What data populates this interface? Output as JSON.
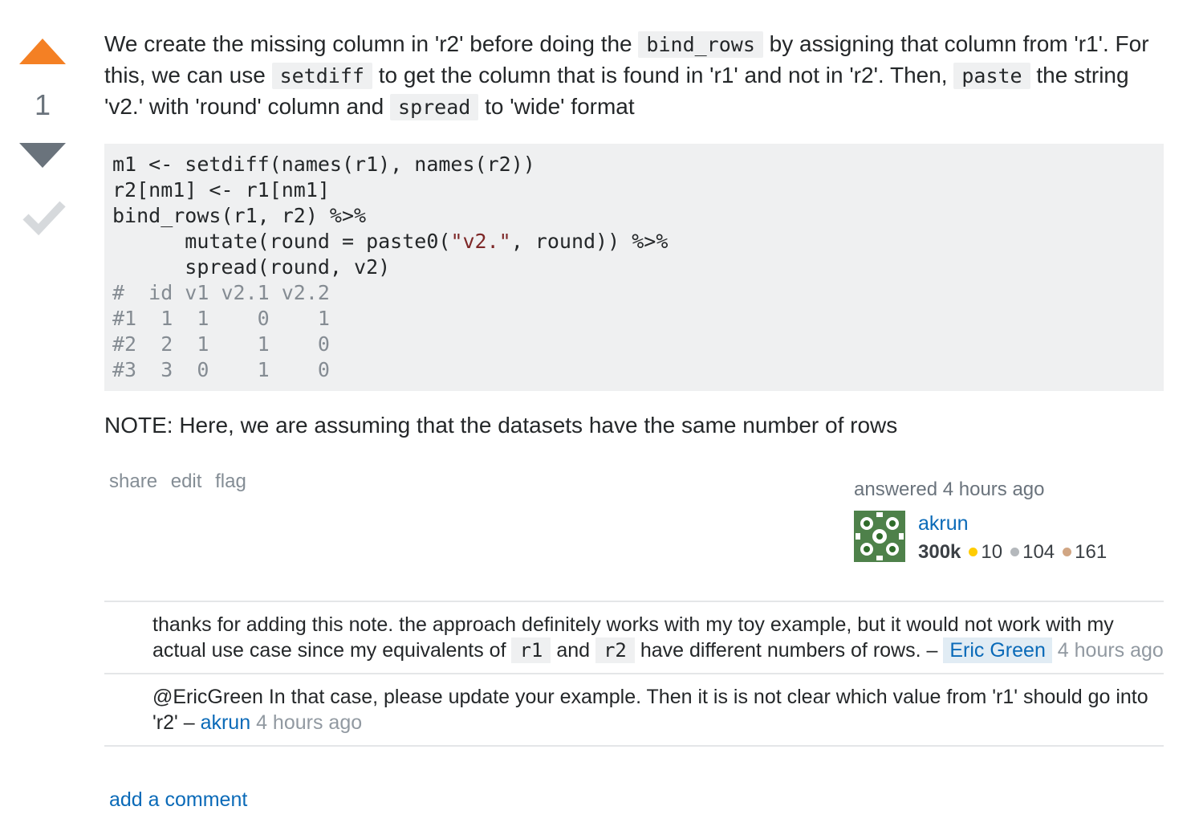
{
  "vote": {
    "count": "1"
  },
  "answer": {
    "text": {
      "p1": "We create the missing column in 'r2' before doing the ",
      "c1": "bind_rows",
      "p2": " by assigning that column from 'r1'. For this, we can use ",
      "c2": "setdiff",
      "p3": " to get the column that is found in 'r1' and not in 'r2'. Then, ",
      "c3": "paste",
      "p4": " the string 'v2.' with 'round' column and ",
      "c4": "spread",
      "p5": " to 'wide' format"
    },
    "code": {
      "line1": "m1 <- setdiff(names(r1), names(r2))",
      "line2": "r2[nm1] <- r1[nm1]",
      "line3": "bind_rows(r1, r2) %>%",
      "line4a": "      mutate(round = paste0(",
      "line4str": "\"v2.\"",
      "line4b": ", round)) %>%",
      "line5": "      spread(round, v2)",
      "out1": "#  id v1 v2.1 v2.2",
      "out2": "#1  1  1    0    1",
      "out3": "#2  2  1    1    0",
      "out4": "#3  3  0    1    0"
    },
    "note": "NOTE: Here, we are assuming that the datasets have the same number of rows"
  },
  "post_menu": {
    "share": "share",
    "edit": "edit",
    "flag": "flag"
  },
  "user_card": {
    "action": "answered 4 hours ago",
    "name": "akrun",
    "reputation": "300k",
    "gold": "10",
    "silver": "104",
    "bronze": "161",
    "colors": {
      "gold": "#ffcc01",
      "silver": "#b4b8bc",
      "bronze": "#d1a684"
    }
  },
  "comments": [
    {
      "t1": "thanks for adding this note. the approach definitely works with my toy example, but it would not work with my actual use case since my equivalents of ",
      "c1": "r1",
      "t2": " and ",
      "c2": "r2",
      "t3": " have different numbers of rows. – ",
      "user": "Eric Green",
      "date": "4 hours ago"
    },
    {
      "t1": "@EricGreen In that case, please update your example. Then it is is not clear which value from 'r1' should go into 'r2' – ",
      "user": "akrun",
      "date": "4 hours ago"
    }
  ],
  "add_comment": "add a comment"
}
